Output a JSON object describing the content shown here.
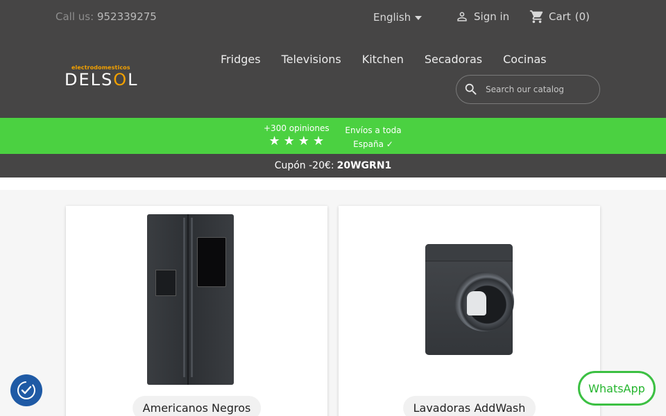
{
  "header": {
    "call_label": "Call us:",
    "phone": "952339275",
    "language": "English",
    "signin": "Sign in",
    "cart": "Cart",
    "cart_count": "(0)"
  },
  "logo": {
    "top": "electrodomesticos",
    "main_prefix": "DELS",
    "main_o": "O",
    "main_suffix": "L"
  },
  "nav": {
    "items": [
      "Fridges",
      "Televisions",
      "Kitchen",
      "Secadoras",
      "Cocinas"
    ]
  },
  "search": {
    "placeholder": "Search our catalog"
  },
  "promo": {
    "opinions": "+300 opiniones",
    "stars": 4,
    "envios_line1": "Envíos a toda",
    "envios_line2": "España ✓"
  },
  "coupon": {
    "label": "Cupón -20€:",
    "code": "20WGRN1"
  },
  "products": [
    {
      "label": "Americanos Negros"
    },
    {
      "label": "Lavadoras AddWash"
    }
  ],
  "whatsapp": "WhatsApp",
  "colors": {
    "topbar": "#464545",
    "green": "#4bd141",
    "accent": "#f3a100",
    "whatsapp": "#25b52e"
  }
}
